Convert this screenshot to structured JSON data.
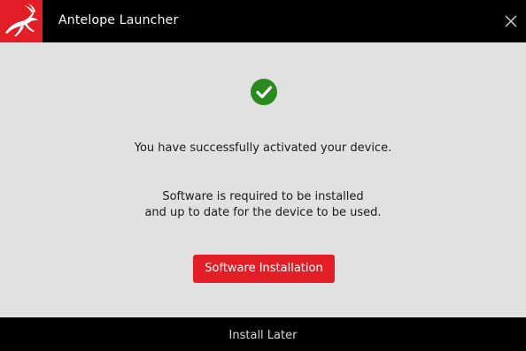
{
  "window": {
    "title": "Antelope Launcher",
    "logo_icon": "antelope-logo-icon",
    "close_icon": "close-icon"
  },
  "main": {
    "status_icon": "checkmark-circle-icon",
    "success_message": "You have successfully activated your device.",
    "requirement_line_1": "Software is required to be installed",
    "requirement_line_2": "and up to date for the device to be used.",
    "install_button_label": "Software Installation"
  },
  "footer": {
    "install_later_label": "Install Later"
  },
  "colors": {
    "brand_red": "#e21f26",
    "success_green": "#2a8a1f",
    "background": "#e1e1e1",
    "bar": "#000000"
  }
}
